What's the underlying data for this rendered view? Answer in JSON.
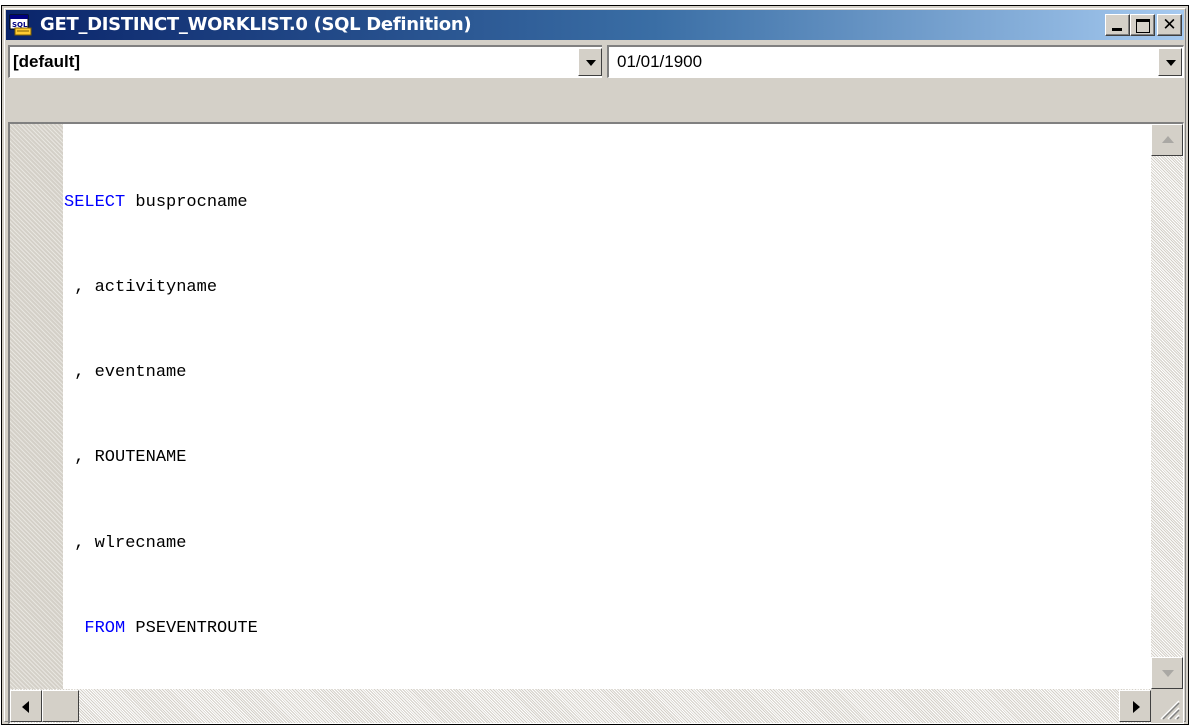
{
  "window": {
    "title": "GET_DISTINCT_WORKLIST.0 (SQL Definition)",
    "icon": "sql-document-icon"
  },
  "controls": {
    "minimize_icon": "minimize-icon",
    "maximize_icon": "maximize-icon",
    "close_glyph": "✕"
  },
  "combos": {
    "database_type": {
      "value": "[default]"
    },
    "effective_date": {
      "value": "01/01/1900"
    }
  },
  "sql": {
    "lines": [
      {
        "keyword": "SELECT",
        "text": " busprocname"
      },
      {
        "keyword": "",
        "text": " , activityname"
      },
      {
        "keyword": "",
        "text": " , eventname"
      },
      {
        "keyword": "",
        "text": " , ROUTENAME"
      },
      {
        "keyword": "",
        "text": " , wlrecname"
      },
      {
        "keyword": "  FROM",
        "text": " PSEVENTROUTE"
      }
    ]
  },
  "colors": {
    "titlebar_start": "#0a246a",
    "titlebar_end": "#a6caf0",
    "keyword": "#0000ff",
    "face": "#d4d0c8"
  }
}
